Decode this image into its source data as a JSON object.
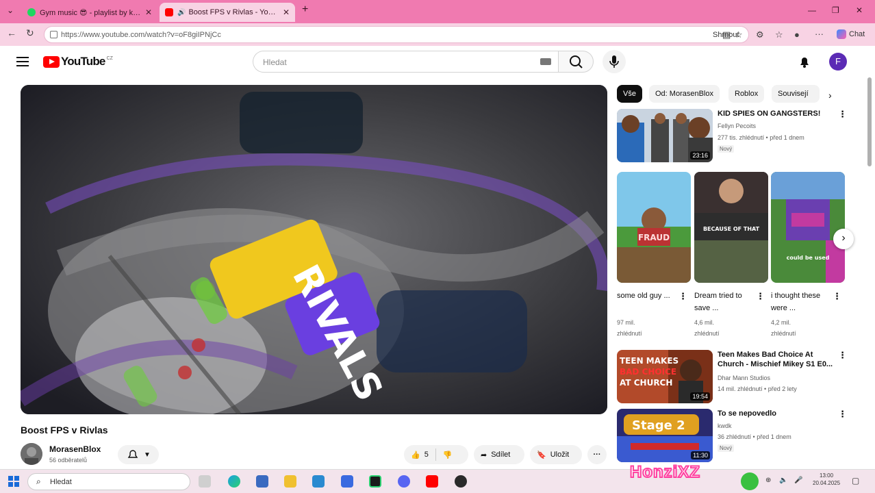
{
  "browser": {
    "tabs": [
      {
        "label": "Gym music 😎 - playlist by kričík | ...",
        "active": false,
        "favicon_color": "#1ed760"
      },
      {
        "label": "Boost FPS v Rivlas - YouTube",
        "active": true,
        "favicon_color": "#ff0000"
      }
    ],
    "new_tab_label": "+",
    "url": "https://www.youtube.com/watch?v=oF8giIPNjCc",
    "unsubscribe_label": "Shrnout",
    "copilot_label": "Chat"
  },
  "youtube": {
    "logo_text": "YouTube",
    "logo_country": "CZ",
    "search_placeholder": "Hledat",
    "avatar_letter": "F"
  },
  "video": {
    "title": "Boost FPS v Rivlas",
    "thumbnail_text": "RIVALS",
    "channel_name": "MorasenBlox",
    "channel_subs": "56 odběratelů",
    "like_count": "5",
    "share_label": "Sdílet",
    "save_label": "Uložit"
  },
  "sidebar": {
    "chips": [
      "Vše",
      "Od: MorasenBlox",
      "Roblox",
      "Souvisejí"
    ],
    "recommendations": [
      {
        "title": "KID SPIES ON GANGSTERS!",
        "channel": "Fellyn Pecoits",
        "meta": "277 tis. zhlédnutí • před 1 dnem",
        "badge": "Nový",
        "duration": "23:16",
        "thumb_color": "#7b8fa8"
      },
      {
        "title": "Teen Makes Bad Choice At Church - Mischief Mikey S1 E0...",
        "channel": "Dhar Mann Studios",
        "meta": "14 mil. zhlédnutí • před 2 lety",
        "badge": "",
        "duration": "19:54",
        "thumb_color": "#b24a2a",
        "thumb_text": [
          "TEEN MAKES",
          "BAD CHOICE",
          "AT CHURCH"
        ]
      },
      {
        "title": "To se nepovedlo",
        "channel": "kwdk",
        "meta": "36 zhlédnutí • před 1 dnem",
        "badge": "Nový",
        "duration": "11:30",
        "thumb_color": "#2a2a6e",
        "thumb_text": [
          "Stage 2"
        ]
      }
    ],
    "shorts": [
      {
        "title": "some old guy ...",
        "views": "97 mil.",
        "views_label": "zhlédnutí",
        "thumb_text": "FRAUD",
        "thumb_color": "#4b9a3c"
      },
      {
        "title": "Dream tried to save ...",
        "views": "4,6 mil.",
        "views_label": "zhlédnutí",
        "thumb_text": "BECAUSE OF THAT",
        "thumb_color": "#2d2d2d"
      },
      {
        "title": "i thought these were ...",
        "views": "4,2 mil.",
        "views_label": "zhlédnutí",
        "thumb_text": "could be used",
        "thumb_color": "#6a3fb0"
      }
    ]
  },
  "taskbar": {
    "search_placeholder": "Hledat",
    "overlay_name": "HonziXZ",
    "time": "13:00",
    "date": "20.04.2025"
  }
}
